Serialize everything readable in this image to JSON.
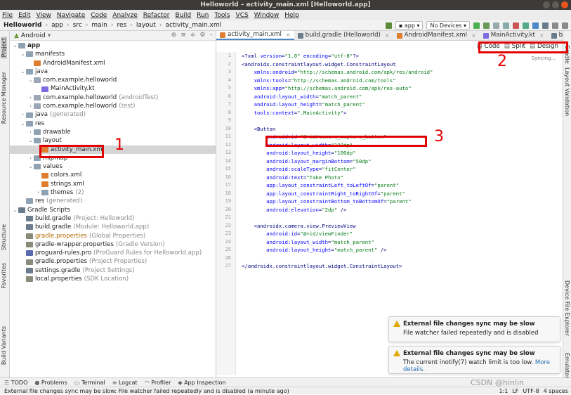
{
  "window": {
    "title": "Helloworld – activity_main.xml [Helloworld.app]"
  },
  "menu": [
    "File",
    "Edit",
    "View",
    "Navigate",
    "Code",
    "Analyze",
    "Refactor",
    "Build",
    "Run",
    "Tools",
    "VCS",
    "Window",
    "Help"
  ],
  "breadcrumb": [
    "Helloworld",
    "app",
    "src",
    "main",
    "res",
    "layout",
    "activity_main.xml"
  ],
  "toolbar": {
    "run_config": "app",
    "device": "No Devices"
  },
  "left_strip": [
    "Project",
    "Resource Manager",
    "Structure",
    "Favorites",
    "Build Variants"
  ],
  "right_strip": [
    "Gradle",
    "Layout Validation",
    "Device File Explorer",
    "Emulator"
  ],
  "project_pane": {
    "view": "Android"
  },
  "tree": [
    {
      "d": 0,
      "a": "v",
      "ic": "folder",
      "t": "app",
      "bold": true
    },
    {
      "d": 1,
      "a": "v",
      "ic": "folder",
      "t": "manifests"
    },
    {
      "d": 2,
      "a": "",
      "ic": "xml",
      "t": "AndroidManifest.xml"
    },
    {
      "d": 1,
      "a": "v",
      "ic": "folder",
      "t": "java"
    },
    {
      "d": 2,
      "a": "v",
      "ic": "pkg",
      "t": "com.example.helloworld"
    },
    {
      "d": 3,
      "a": "",
      "ic": "kt",
      "t": "MainActivity.kt"
    },
    {
      "d": 2,
      "a": ">",
      "ic": "pkg",
      "t": "com.example.helloworld",
      "dim": "(androidTest)"
    },
    {
      "d": 2,
      "a": ">",
      "ic": "pkg",
      "t": "com.example.helloworld",
      "dim": "(test)"
    },
    {
      "d": 1,
      "a": ">",
      "ic": "folder",
      "t": "java",
      "dim": "(generated)"
    },
    {
      "d": 1,
      "a": "v",
      "ic": "folder",
      "t": "res"
    },
    {
      "d": 2,
      "a": ">",
      "ic": "folder",
      "t": "drawable"
    },
    {
      "d": 2,
      "a": "v",
      "ic": "folder",
      "t": "layout"
    },
    {
      "d": 3,
      "a": "",
      "ic": "xml",
      "t": "activity_main.xml",
      "sel": true
    },
    {
      "d": 2,
      "a": ">",
      "ic": "folder",
      "t": "mipmap"
    },
    {
      "d": 2,
      "a": "v",
      "ic": "folder",
      "t": "values"
    },
    {
      "d": 3,
      "a": "",
      "ic": "xml",
      "t": "colors.xml"
    },
    {
      "d": 3,
      "a": "",
      "ic": "xml",
      "t": "strings.xml"
    },
    {
      "d": 3,
      "a": ">",
      "ic": "folder",
      "t": "themes",
      "dim": "(2)"
    },
    {
      "d": 1,
      "a": "",
      "ic": "folder",
      "t": "res",
      "dim": "(generated)"
    },
    {
      "d": 0,
      "a": "v",
      "ic": "grad",
      "t": "Gradle Scripts"
    },
    {
      "d": 1,
      "a": "",
      "ic": "grad",
      "t": "build.gradle",
      "dim": "(Project: Helloworld)"
    },
    {
      "d": 1,
      "a": "",
      "ic": "grad",
      "t": "build.gradle",
      "dim": "(Module: Helloworld.app)"
    },
    {
      "d": 1,
      "a": "",
      "ic": "prop",
      "t": "gradle.properties",
      "dim": "(Global Properties)",
      "ora": true
    },
    {
      "d": 1,
      "a": "",
      "ic": "prop",
      "t": "gradle-wrapper.properties",
      "dim": "(Gradle Version)"
    },
    {
      "d": 1,
      "a": "",
      "ic": "pro",
      "t": "proguard-rules.pro",
      "dim": "(ProGuard Rules for Helloworld.app)"
    },
    {
      "d": 1,
      "a": "",
      "ic": "prop",
      "t": "gradle.properties",
      "dim": "(Project Properties)"
    },
    {
      "d": 1,
      "a": "",
      "ic": "grad",
      "t": "settings.gradle",
      "dim": "(Project Settings)"
    },
    {
      "d": 1,
      "a": "",
      "ic": "prop",
      "t": "local.properties",
      "dim": "(SDK Location)"
    }
  ],
  "tabs": [
    {
      "label": "activity_main.xml",
      "active": true
    },
    {
      "label": "build.gradle (Helloworld)"
    },
    {
      "label": "AndroidManifest.xml"
    },
    {
      "label": "MainActivity.kt"
    },
    {
      "label": "build.g"
    }
  ],
  "view_modes": [
    "Code",
    "Split",
    "Design"
  ],
  "syncing": "Syncing...",
  "code": [
    "<?xml version=\"1.0\" encoding=\"utf-8\"?>",
    "<androidx.constraintlayout.widget.ConstraintLayout",
    "    xmlns:android=\"http://schemas.android.com/apk/res/android\"",
    "    xmlns:tools=\"http://schemas.android.com/tools\"",
    "    xmlns:app=\"http://schemas.android.com/apk/res-auto\"",
    "    android:layout_width=\"match_parent\"",
    "    android:layout_height=\"match_parent\"",
    "    tools:context=\".MainActivity\">",
    "",
    "    <Button",
    "        android:id=\"@+id/camera_capture_button\"",
    "        android:layout_width=\"100dp\"",
    "        android:layout_height=\"100dp\"",
    "        android:layout_marginBottom=\"50dp\"",
    "        android:scaleType=\"fitCenter\"",
    "        android:text=\"Take Photo\"",
    "        app:layout_constraintLeft_toLeftOf=\"parent\"",
    "        app:layout_constraintRight_toRightOf=\"parent\"",
    "        app:layout_constraintBottom_toBottomOf=\"parent\"",
    "        android:elevation=\"2dp\" />",
    "",
    "    <androidx.camera.view.PreviewView",
    "        android:id=\"@+id/viewFinder\"",
    "        android:layout_width=\"match_parent\"",
    "        android:layout_height=\"match_parent\" />",
    "",
    "</androidx.constraintlayout.widget.ConstraintLayout>"
  ],
  "annotations": [
    "1",
    "2",
    "3"
  ],
  "notifications": [
    {
      "title": "External file changes sync may be slow",
      "body": "File watcher failed repeatedly and is disabled",
      "more": ""
    },
    {
      "title": "External file changes sync may be slow",
      "body": "The current inotify(7) watch limit is too low.",
      "more": "More details."
    }
  ],
  "bottom_tabs": [
    "TODO",
    "Problems",
    "Terminal",
    "Logcat",
    "Profiler",
    "App Inspection"
  ],
  "status": {
    "message": "External file changes sync may be slow: File watcher failed repeatedly and is disabled (a minute ago)",
    "position": "1:1",
    "line_sep": "LF",
    "encoding": "UTF-8",
    "indent": "4 spaces"
  },
  "watermark": "CSDN @hinlin",
  "colors": {
    "annotation": "#e30000",
    "warning": "#e0a700",
    "accent": "#4a88c7"
  }
}
